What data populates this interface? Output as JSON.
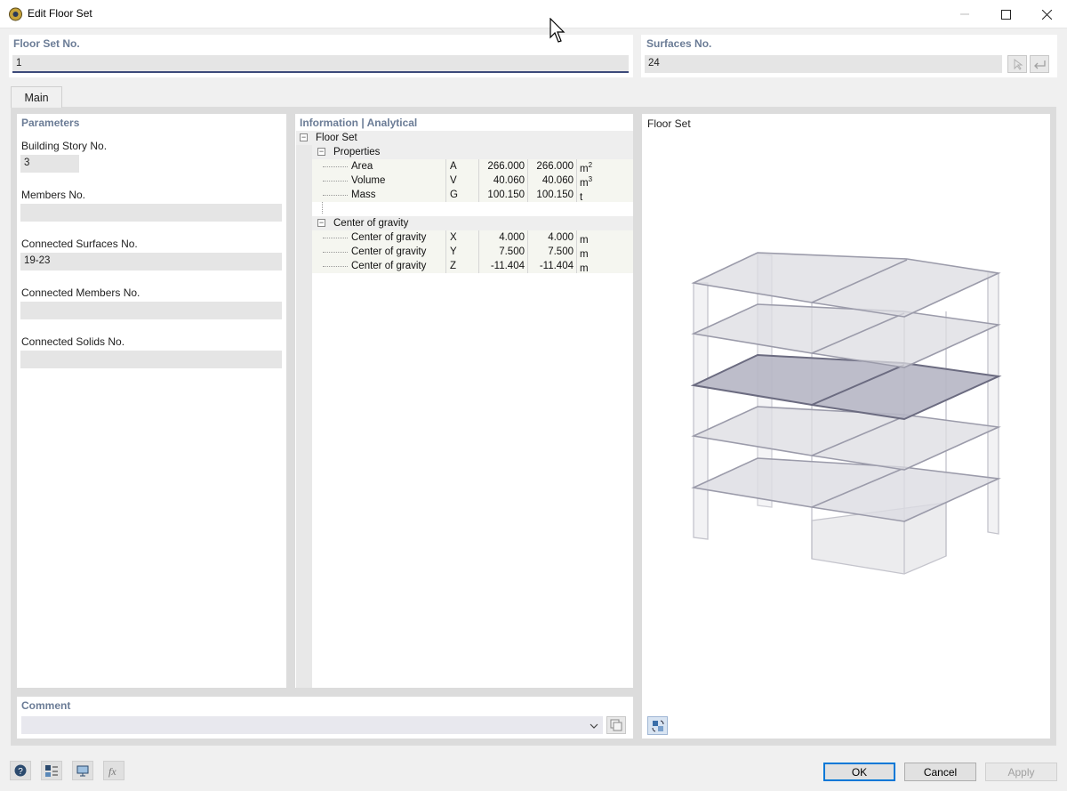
{
  "window": {
    "title": "Edit Floor Set"
  },
  "header": {
    "floor_set_no": {
      "label": "Floor Set No.",
      "value": "1"
    },
    "surfaces_no": {
      "label": "Surfaces No.",
      "value": "24"
    }
  },
  "tabs": [
    {
      "label": "Main"
    }
  ],
  "parameters": {
    "title": "Parameters",
    "building_story": {
      "label": "Building Story No.",
      "value": "3"
    },
    "members": {
      "label": "Members No.",
      "value": ""
    },
    "connected_surfaces": {
      "label": "Connected Surfaces No.",
      "value": "19-23"
    },
    "connected_members": {
      "label": "Connected Members No.",
      "value": ""
    },
    "connected_solids": {
      "label": "Connected Solids No.",
      "value": ""
    }
  },
  "info": {
    "title": "Information | Analytical",
    "root": "Floor Set",
    "properties": {
      "label": "Properties",
      "rows": [
        {
          "name": "Area",
          "sym": "A",
          "v1": "266.000",
          "v2": "266.000",
          "unit": "m",
          "sup": "2"
        },
        {
          "name": "Volume",
          "sym": "V",
          "v1": "40.060",
          "v2": "40.060",
          "unit": "m",
          "sup": "3"
        },
        {
          "name": "Mass",
          "sym": "G",
          "v1": "100.150",
          "v2": "100.150",
          "unit": "t",
          "sup": ""
        }
      ]
    },
    "center": {
      "label": "Center of gravity",
      "rows": [
        {
          "name": "Center of gravity",
          "sym": "X",
          "v1": "4.000",
          "v2": "4.000",
          "unit": "m",
          "sup": ""
        },
        {
          "name": "Center of gravity",
          "sym": "Y",
          "v1": "7.500",
          "v2": "7.500",
          "unit": "m",
          "sup": ""
        },
        {
          "name": "Center of gravity",
          "sym": "Z",
          "v1": "-11.404",
          "v2": "-11.404",
          "unit": "m",
          "sup": ""
        }
      ]
    }
  },
  "preview": {
    "title": "Floor Set"
  },
  "comment": {
    "label": "Comment",
    "value": ""
  },
  "buttons": {
    "ok": "OK",
    "cancel": "Cancel",
    "apply": "Apply"
  },
  "icons": {
    "app": "app-logo-icon",
    "pick_surface": "pick-cursor-icon",
    "undo": "return-arrow-icon",
    "view_toggle": "view-rotate-icon",
    "comment_library": "library-icon",
    "bottom": [
      "help-icon",
      "properties-icon",
      "display-icon",
      "function-icon"
    ]
  },
  "colors": {
    "accent": "#0078d7",
    "group_title": "#6b7c96",
    "selected_floor": "#9b9bb0"
  }
}
